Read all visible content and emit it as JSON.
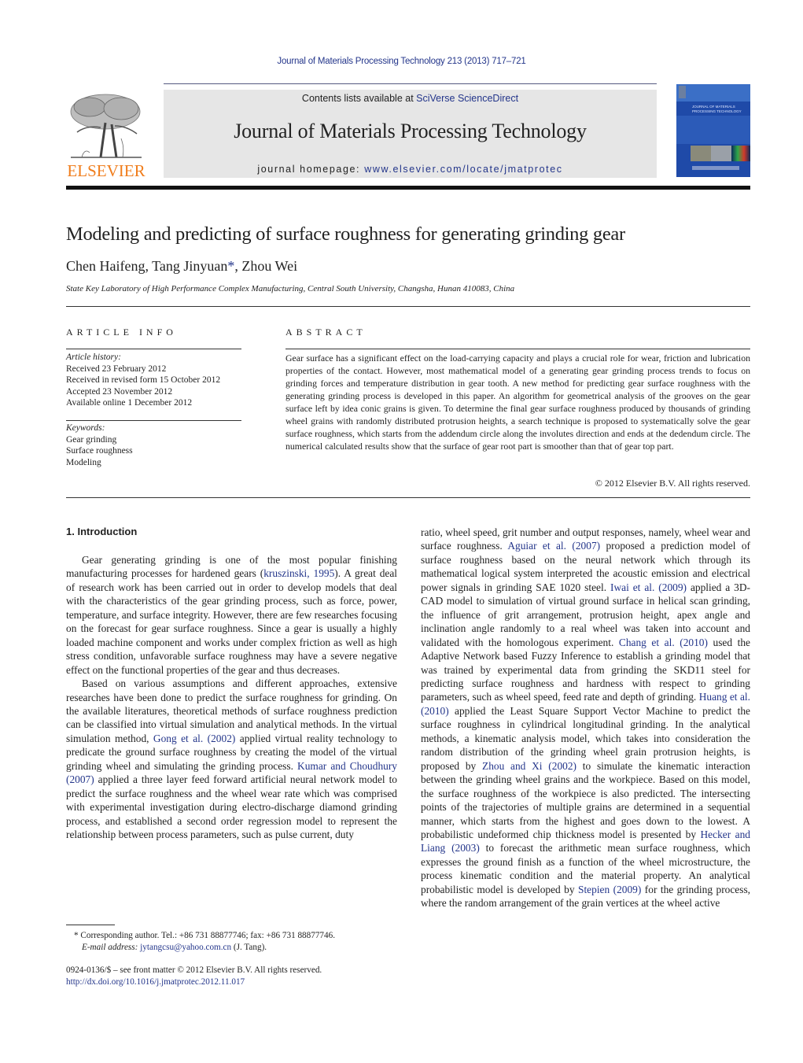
{
  "header": {
    "running_head": "Journal of Materials Processing Technology 213 (2013) 717–721",
    "publisher_logo_text": "ELSEVIER",
    "contents_prefix": "Contents lists available at ",
    "contents_link": "SciVerse ScienceDirect",
    "journal_title": "Journal of Materials Processing Technology",
    "homepage_prefix": "journal homepage: ",
    "homepage_link": "www.elsevier.com/locate/jmatprotec",
    "cover_title": "JOURNAL OF MATERIALS PROCESSING TECHNOLOGY"
  },
  "article": {
    "title": "Modeling and predicting of surface roughness for generating grinding gear",
    "authors": {
      "part1": "Chen Haifeng, Tang Jinyuan",
      "corresponding_mark": "*",
      "part2": ", Zhou Wei"
    },
    "affiliation": "State Key Laboratory of High Performance Complex Manufacturing, Central South University, Changsha, Hunan 410083, China"
  },
  "article_info": {
    "heading": "ARTICLE INFO",
    "history_label": "Article history:",
    "history": [
      "Received 23 February 2012",
      "Received in revised form 15 October 2012",
      "Accepted 23 November 2012",
      "Available online 1 December 2012"
    ],
    "keywords_label": "Keywords:",
    "keywords": [
      "Gear grinding",
      "Surface roughness",
      "Modeling"
    ]
  },
  "abstract": {
    "heading": "ABSTRACT",
    "text": "Gear surface has a significant effect on the load-carrying capacity and plays a crucial role for wear, friction and lubrication properties of the contact. However, most mathematical model of a generating gear grinding process trends to focus on grinding forces and temperature distribution in gear tooth. A new method for predicting gear surface roughness with the generating grinding process is developed in this paper. An algorithm for geometrical analysis of the grooves on the gear surface left by idea conic grains is given. To determine the final gear surface roughness produced by thousands of grinding wheel grains with randomly distributed protrusion heights, a search technique is proposed to systematically solve the gear surface roughness, which starts from the addendum circle along the involutes direction and ends at the dedendum circle. The numerical calculated results show that the surface of gear root part is smoother than that of gear top part.",
    "copyright": "© 2012 Elsevier B.V. All rights reserved."
  },
  "body": {
    "section_heading": "1.  Introduction",
    "left_p1": [
      {
        "t": "Gear generating grinding is one of the most popular finishing manufacturing processes for hardened gears ("
      },
      {
        "t": "kruszinski, 1995",
        "link": true
      },
      {
        "t": "). A great deal of research work has been carried out in order to develop models that deal with the characteristics of the gear grinding process, such as force, power, temperature, and surface integrity. However, there are few researches focusing on the forecast for gear surface roughness. Since a gear is usually a highly loaded machine component and works under complex friction as well as high stress condition, unfavorable surface roughness may have a severe negative effect on the functional properties of the gear and thus decreases."
      }
    ],
    "left_p2": [
      {
        "t": "Based on various assumptions and different approaches, extensive researches have been done to predict the surface roughness for grinding. On the available literatures, theoretical methods of surface roughness prediction can be classified into virtual simulation and analytical methods. In the virtual simulation method, "
      },
      {
        "t": "Gong et al. (2002)",
        "link": true
      },
      {
        "t": " applied virtual reality technology to predicate the ground surface roughness by creating the model of the virtual grinding wheel and simulating the grinding process. "
      },
      {
        "t": "Kumar and Choudhury (2007)",
        "link": true
      },
      {
        "t": " applied a three layer feed forward artificial neural network model to predict the surface roughness and the wheel wear rate which was comprised with experimental investigation during electro-discharge diamond grinding process, and established a second order regression model to represent the relationship between process parameters, such as pulse current, duty"
      }
    ],
    "right_p1": [
      {
        "t": "ratio, wheel speed, grit number and output responses, namely, wheel wear and surface roughness. "
      },
      {
        "t": "Aguiar et al. (2007)",
        "link": true
      },
      {
        "t": " proposed a prediction model of surface roughness based on the neural network which through its mathematical logical system interpreted the acoustic emission and electrical power signals in grinding SAE 1020 steel. "
      },
      {
        "t": "Iwai et al. (2009)",
        "link": true
      },
      {
        "t": " applied a 3D-CAD model to simulation of virtual ground surface in helical scan grinding, the influence of grit arrangement, protrusion height, apex angle and inclination angle randomly to a real wheel was taken into account and validated with the homologous experiment. "
      },
      {
        "t": "Chang et al. (2010)",
        "link": true
      },
      {
        "t": " used the Adaptive Network based Fuzzy Inference to establish a grinding model that was trained by experimental data from grinding the SKD11 steel for predicting surface roughness and hardness with respect to grinding parameters, such as wheel speed, feed rate and depth of grinding. "
      },
      {
        "t": "Huang et al. (2010)",
        "link": true
      },
      {
        "t": " applied the Least Square Support Vector Machine to predict the surface roughness in cylindrical longitudinal grinding. In the analytical methods, a kinematic analysis model, which takes into consideration the random distribution of the grinding wheel grain protrusion heights, is proposed by "
      },
      {
        "t": "Zhou and Xi (2002)",
        "link": true
      },
      {
        "t": " to simulate the kinematic interaction between the grinding wheel grains and the workpiece. Based on this model, the surface roughness of the workpiece is also predicted. The intersecting points of the trajectories of multiple grains are determined in a sequential manner, which starts from the highest and goes down to the lowest. A probabilistic undeformed chip thickness model is presented by "
      },
      {
        "t": "Hecker and Liang (2003)",
        "link": true
      },
      {
        "t": " to forecast the arithmetic mean surface roughness, which expresses the ground finish as a function of the wheel microstructure, the process kinematic condition and the material property. An analytical probabilistic model is developed by "
      },
      {
        "t": "Stepien (2009)",
        "link": true
      },
      {
        "t": " for the grinding process, where the random arrangement of the grain vertices at the wheel active"
      }
    ]
  },
  "footnote": {
    "mark": "*",
    "corresponding": " Corresponding author. Tel.: +86 731 88877746; fax: +86 731 88877746.",
    "email_label": "E-mail address:",
    "email": "jytangcsu@yahoo.com.cn",
    "email_suffix": " (J. Tang).",
    "issn_line": "0924-0136/$ – see front matter © 2012 Elsevier B.V. All rights reserved.",
    "doi": "http://dx.doi.org/10.1016/j.jmatprotec.2012.11.017"
  },
  "colors": {
    "link": "#23358a",
    "elsevier_orange": "#f07d1c",
    "masthead_bg": "#e6e6e6",
    "cover_blue": "#1f4aa8"
  }
}
